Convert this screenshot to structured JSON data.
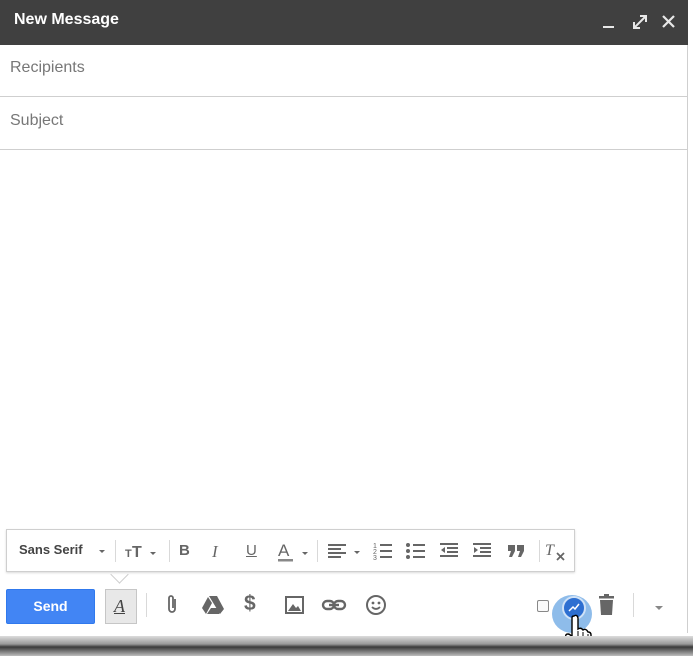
{
  "window": {
    "title": "New Message",
    "minimize_icon": "minimize-icon",
    "popout_icon": "expand-icon",
    "close_icon": "close-icon"
  },
  "fields": {
    "recipients_placeholder": "Recipients",
    "subject_placeholder": "Subject"
  },
  "format_toolbar": {
    "font": "Sans Serif",
    "items": [
      "font-size-icon",
      "bold-icon",
      "italic-icon",
      "underline-icon",
      "text-color-icon",
      "align-icon",
      "numbered-list-icon",
      "bulleted-list-icon",
      "indent-less-icon",
      "indent-more-icon",
      "quote-icon",
      "remove-formatting-icon"
    ],
    "bold": "B",
    "italic": "I",
    "underline": "U",
    "text_color": "A"
  },
  "bottom_toolbar": {
    "send_label": "Send",
    "formatting_toggle": "A",
    "dollar": "$",
    "accent": "#4285f4"
  },
  "colors": {
    "titlebar": "#404040",
    "send_button": "#4285f4"
  }
}
